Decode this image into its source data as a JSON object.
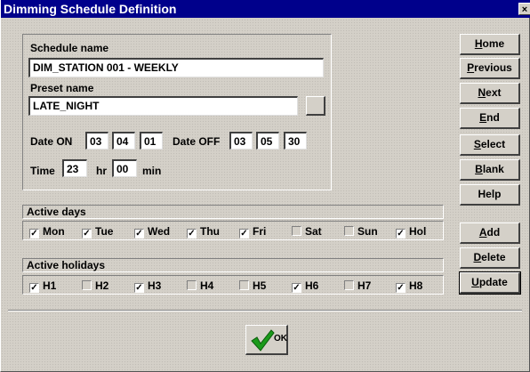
{
  "window": {
    "title": "Dimming Schedule Definition",
    "close_glyph": "×"
  },
  "schedule": {
    "name_label": "Schedule name",
    "name_value": "DIM_STATION 001 - WEEKLY",
    "preset_label": "Preset name",
    "preset_value": "LATE_NIGHT",
    "date_on_label": "Date ON",
    "date_on": [
      "03",
      "04",
      "01"
    ],
    "date_off_label": "Date OFF",
    "date_off": [
      "03",
      "05",
      "30"
    ],
    "time_label": "Time",
    "hour": "23",
    "hr_label": "hr",
    "minute": "00",
    "min_label": "min"
  },
  "active_days": {
    "label": "Active days",
    "items": [
      {
        "label": "Mon",
        "checked": true
      },
      {
        "label": "Tue",
        "checked": true
      },
      {
        "label": "Wed",
        "checked": true
      },
      {
        "label": "Thu",
        "checked": true
      },
      {
        "label": "Fri",
        "checked": true
      },
      {
        "label": "Sat",
        "checked": false
      },
      {
        "label": "Sun",
        "checked": false
      },
      {
        "label": "Hol",
        "checked": true
      }
    ]
  },
  "active_holidays": {
    "label": "Active holidays",
    "items": [
      {
        "label": "H1",
        "checked": true
      },
      {
        "label": "H2",
        "checked": false
      },
      {
        "label": "H3",
        "checked": true
      },
      {
        "label": "H4",
        "checked": false
      },
      {
        "label": "H5",
        "checked": false
      },
      {
        "label": "H6",
        "checked": true
      },
      {
        "label": "H7",
        "checked": false
      },
      {
        "label": "H8",
        "checked": true
      }
    ]
  },
  "buttons": {
    "home": {
      "first": "H",
      "rest": "ome"
    },
    "previous": {
      "first": "P",
      "rest": "revious"
    },
    "next": {
      "first": "N",
      "rest": "ext"
    },
    "end": {
      "first": "E",
      "rest": "nd"
    },
    "select": {
      "first": "S",
      "rest": "elect"
    },
    "blank": {
      "first": "B",
      "rest": "lank"
    },
    "help": {
      "first": "",
      "rest": "Help"
    },
    "add": {
      "first": "A",
      "rest": "dd"
    },
    "delete": {
      "first": "D",
      "rest": "elete"
    },
    "update": {
      "first": "U",
      "rest": "pdate"
    },
    "ok": "OK"
  },
  "icons": {
    "ok": "checkmark-icon",
    "close": "close-icon",
    "browse": "browse-icon"
  },
  "colors": {
    "titlebar": "#00008b",
    "face": "#d4d0c8",
    "check_green": "#1a9a1a"
  }
}
